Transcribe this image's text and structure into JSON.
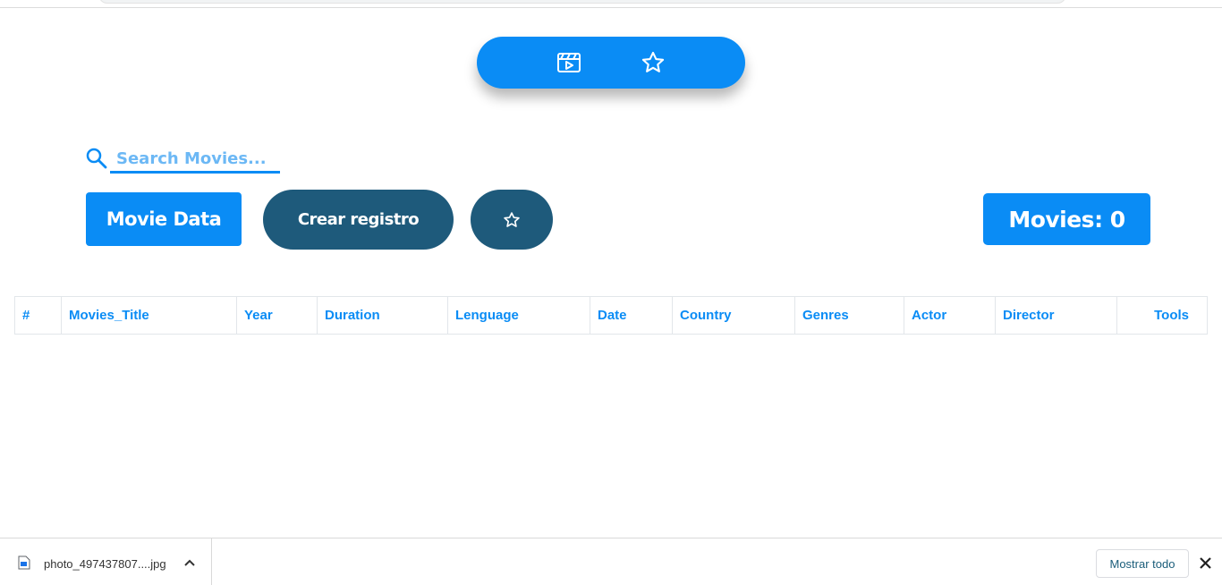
{
  "nav": {
    "items": [
      {
        "icon": "film-icon",
        "active": true
      },
      {
        "icon": "star-icon",
        "active": false
      }
    ]
  },
  "search": {
    "placeholder": "Search Movies...",
    "value": ""
  },
  "actions": {
    "movie_data_label": "Movie Data",
    "crear_label": "Crear registro",
    "favorites_icon": "star-icon",
    "count_label": "Movies: 0"
  },
  "table": {
    "columns": [
      "#",
      "Movies_Title",
      "Year",
      "Duration",
      "Lenguage",
      "Date",
      "Country",
      "Genres",
      "Actor",
      "Director",
      "Tools"
    ],
    "rows": []
  },
  "downloads": {
    "filename": "photo_497437807....jpg",
    "show_all_label": "Mostrar todo"
  },
  "colors": {
    "primary": "#0a8cf5",
    "secondary": "#1e5a7b"
  }
}
